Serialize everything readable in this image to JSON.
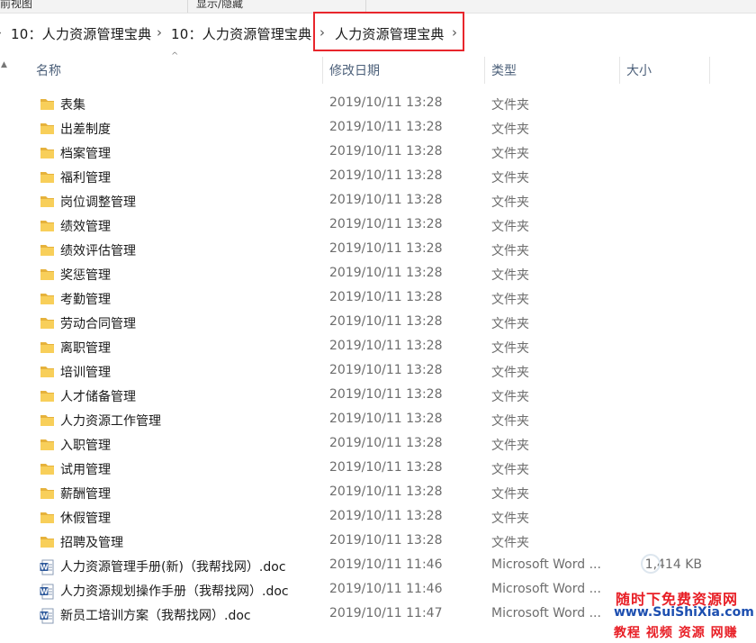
{
  "ribbon": {
    "left_label": "前视图",
    "middle_label": "显示/隐藏"
  },
  "breadcrumb": {
    "items": [
      "10：人力资源管理宝典",
      "10：人力资源管理宝典",
      "人力资源管理宝典"
    ]
  },
  "columns": {
    "name": "名称",
    "date": "修改日期",
    "type": "类型",
    "size": "大小"
  },
  "files": [
    {
      "name": "表集",
      "date": "2019/10/11 13:28",
      "type": "文件夹",
      "size": "",
      "icon": "folder-icon"
    },
    {
      "name": "出差制度",
      "date": "2019/10/11 13:28",
      "type": "文件夹",
      "size": "",
      "icon": "folder-icon"
    },
    {
      "name": "档案管理",
      "date": "2019/10/11 13:28",
      "type": "文件夹",
      "size": "",
      "icon": "folder-icon"
    },
    {
      "name": "福利管理",
      "date": "2019/10/11 13:28",
      "type": "文件夹",
      "size": "",
      "icon": "folder-icon"
    },
    {
      "name": "岗位调整管理",
      "date": "2019/10/11 13:28",
      "type": "文件夹",
      "size": "",
      "icon": "folder-icon"
    },
    {
      "name": "绩效管理",
      "date": "2019/10/11 13:28",
      "type": "文件夹",
      "size": "",
      "icon": "folder-icon"
    },
    {
      "name": "绩效评估管理",
      "date": "2019/10/11 13:28",
      "type": "文件夹",
      "size": "",
      "icon": "folder-icon"
    },
    {
      "name": "奖惩管理",
      "date": "2019/10/11 13:28",
      "type": "文件夹",
      "size": "",
      "icon": "folder-icon"
    },
    {
      "name": "考勤管理",
      "date": "2019/10/11 13:28",
      "type": "文件夹",
      "size": "",
      "icon": "folder-icon"
    },
    {
      "name": "劳动合同管理",
      "date": "2019/10/11 13:28",
      "type": "文件夹",
      "size": "",
      "icon": "folder-icon"
    },
    {
      "name": "离职管理",
      "date": "2019/10/11 13:28",
      "type": "文件夹",
      "size": "",
      "icon": "folder-icon"
    },
    {
      "name": "培训管理",
      "date": "2019/10/11 13:28",
      "type": "文件夹",
      "size": "",
      "icon": "folder-icon"
    },
    {
      "name": "人才储备管理",
      "date": "2019/10/11 13:28",
      "type": "文件夹",
      "size": "",
      "icon": "folder-icon"
    },
    {
      "name": "人力资源工作管理",
      "date": "2019/10/11 13:28",
      "type": "文件夹",
      "size": "",
      "icon": "folder-icon"
    },
    {
      "name": "入职管理",
      "date": "2019/10/11 13:28",
      "type": "文件夹",
      "size": "",
      "icon": "folder-icon"
    },
    {
      "name": "试用管理",
      "date": "2019/10/11 13:28",
      "type": "文件夹",
      "size": "",
      "icon": "folder-icon"
    },
    {
      "name": "薪酬管理",
      "date": "2019/10/11 13:28",
      "type": "文件夹",
      "size": "",
      "icon": "folder-icon"
    },
    {
      "name": "休假管理",
      "date": "2019/10/11 13:28",
      "type": "文件夹",
      "size": "",
      "icon": "folder-icon"
    },
    {
      "name": "招聘及管理",
      "date": "2019/10/11 13:28",
      "type": "文件夹",
      "size": "",
      "icon": "folder-icon"
    },
    {
      "name": "人力资源管理手册(新)（我帮找网）.doc",
      "date": "2019/10/11 11:46",
      "type": "Microsoft Word ...",
      "size": "1,414 KB",
      "icon": "word-doc-icon"
    },
    {
      "name": "人力资源规划操作手册（我帮找网）.doc",
      "date": "2019/10/11 11:46",
      "type": "Microsoft Word ...",
      "size": "",
      "icon": "word-doc-icon"
    },
    {
      "name": "新员工培训方案（我帮找网）.doc",
      "date": "2019/10/11 11:47",
      "type": "Microsoft Word ...",
      "size": "",
      "icon": "word-doc-icon"
    }
  ],
  "watermark": {
    "line1": "随时下免费资源网",
    "line2": "www.SuiShiXia.com",
    "line3": "教程 视频 资源 网赚"
  },
  "colors": {
    "highlight_border": "#e8262c",
    "header_text": "#4c607a",
    "folder": "#f8cf5a"
  }
}
